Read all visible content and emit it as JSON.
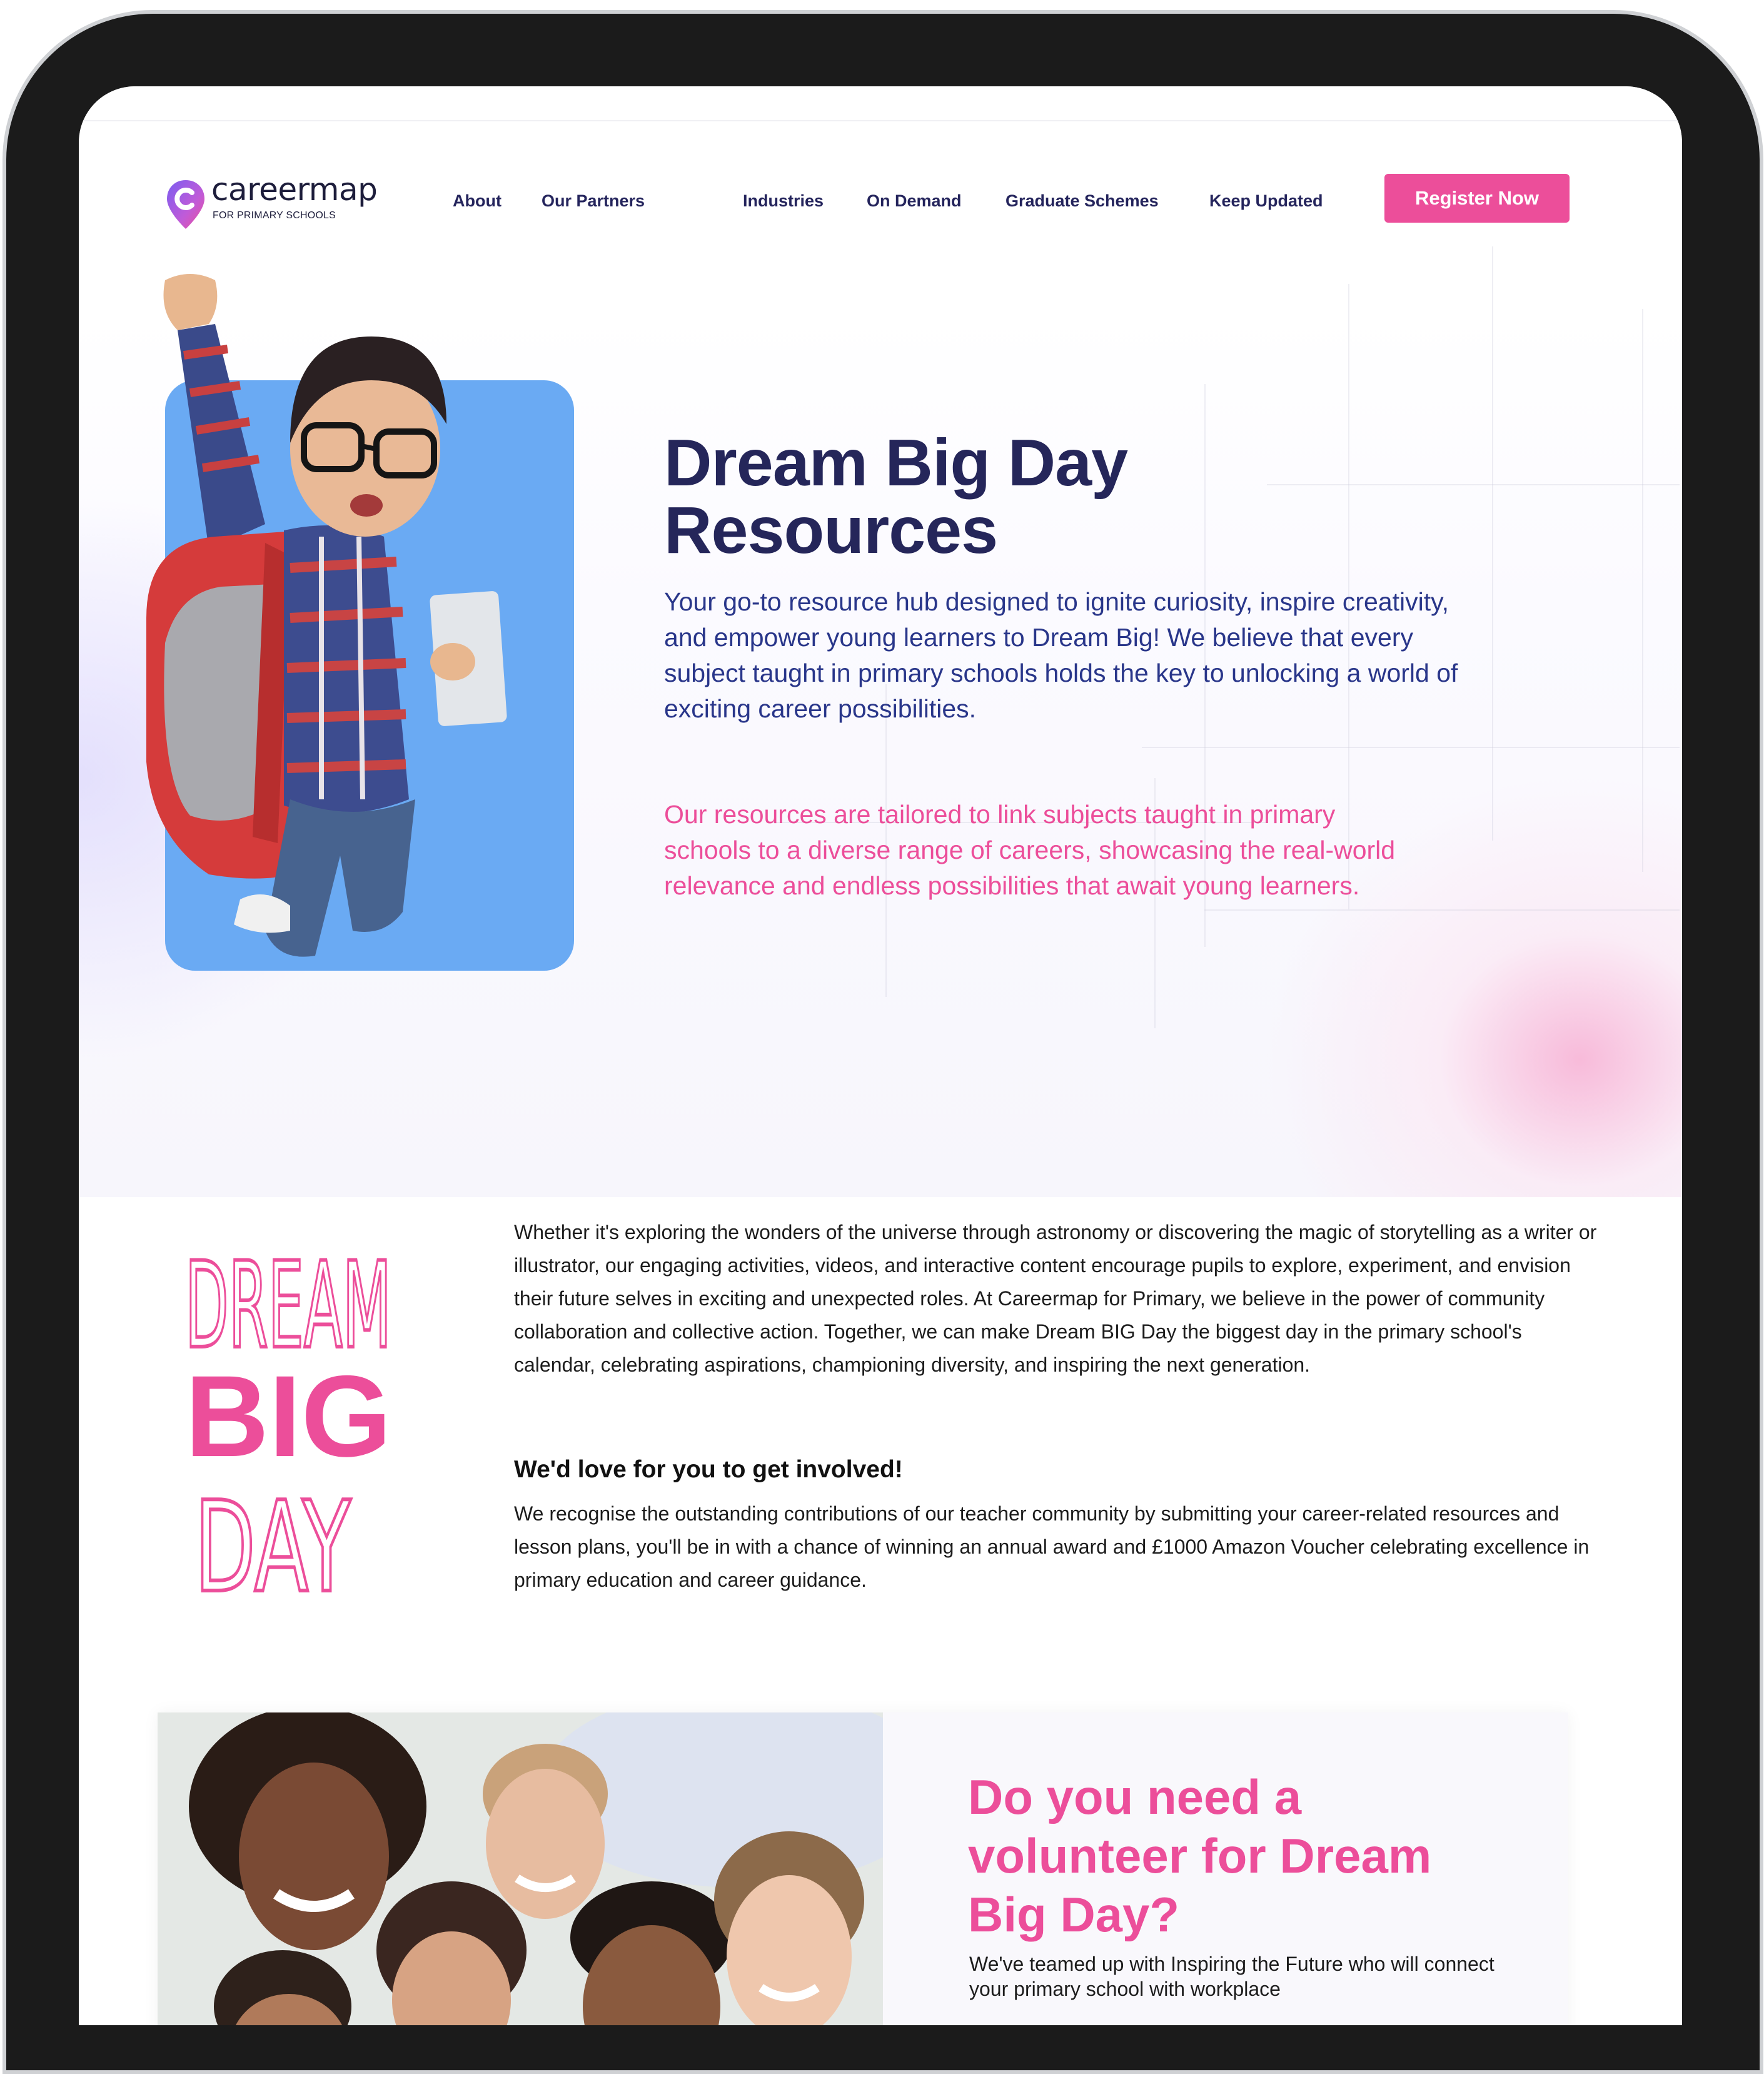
{
  "brand": {
    "name": "careermap",
    "subtitle": "FOR PRIMARY SCHOOLS",
    "primary_color": "#25265a",
    "accent_color": "#ec4e9a",
    "photo_bg_color": "#6aaaf3"
  },
  "nav": {
    "items": [
      {
        "label": "About"
      },
      {
        "label": "Our Partners"
      },
      {
        "label": "Industries"
      },
      {
        "label": "On Demand"
      },
      {
        "label": "Graduate Schemes"
      },
      {
        "label": "Keep Updated"
      }
    ],
    "cta_label": "Register Now"
  },
  "hero": {
    "title_line1": "Dream Big Day",
    "title_line2": "Resources",
    "description": "Your go-to resource hub designed to ignite curiosity, inspire creativity, and empower young learners to Dream Big! We believe that every subject taught in primary schools holds the key to unlocking a world of exciting career possibilities.",
    "description_pink": "Our resources are tailored to link subjects taught in primary schools to a diverse range of careers, showcasing the real-world relevance and endless possibilities that await young learners."
  },
  "dream_big_logo": {
    "line1": "DREAM",
    "line2": "BIG",
    "line3": "DAY"
  },
  "intro": {
    "paragraph": "Whether it's exploring the wonders of the universe through astronomy or discovering the magic of storytelling as a writer or illustrator, our engaging activities, videos, and interactive content encourage pupils to explore, experiment, and envision their future selves in exciting and unexpected roles. At Careermap for Primary, we believe in the power of community collaboration and collective action. Together, we can make Dream BIG Day the biggest day in the primary school's calendar, celebrating aspirations, championing diversity, and inspiring the next generation.",
    "heading": "We'd love for you to get involved!",
    "paragraph2": "We recognise the outstanding contributions of our teacher community by submitting your career-related resources and lesson plans, you'll be in with a chance of winning an annual award and £1000 Amazon Voucher celebrating excellence in primary education and career guidance."
  },
  "volunteer": {
    "title_line1": "Do you need a",
    "title_line2": "volunteer for Dream",
    "title_line3": "Big Day?",
    "text": "We've teamed up with Inspiring the Future who will connect your primary school with workplace"
  }
}
